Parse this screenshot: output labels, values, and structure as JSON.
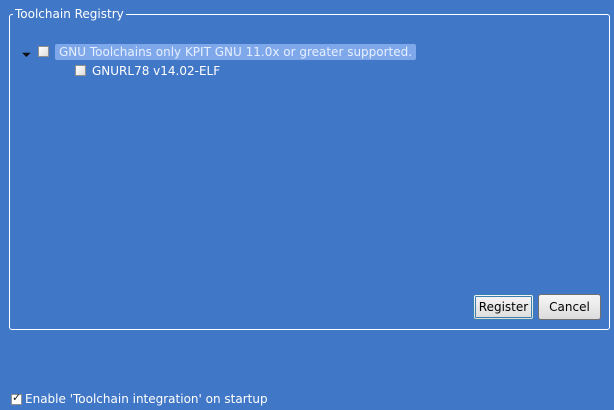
{
  "group": {
    "title": "Toolchain Registry"
  },
  "tree": {
    "root": {
      "label": "GNU Toolchains only KPIT GNU 11.0x or greater supported."
    },
    "children": [
      {
        "label": "GNURL78 v14.02-ELF"
      }
    ]
  },
  "buttons": {
    "register": "Register",
    "cancel": "Cancel"
  },
  "startup": {
    "label": "Enable 'Toolchain integration' on startup"
  },
  "icons": {
    "expander": "expander-triangle-icon",
    "checkmark": "checkmark-icon"
  },
  "colors": {
    "background": "#4077c7",
    "selection": "#7ea8ea"
  }
}
